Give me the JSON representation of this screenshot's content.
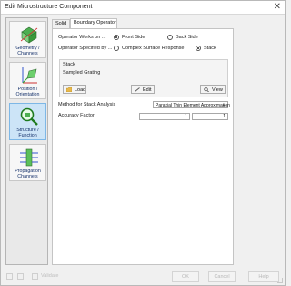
{
  "window": {
    "title": "Edit Microstructure Component"
  },
  "sidebar": {
    "items": [
      {
        "label_line1": "Geometry /",
        "label_line2": "Channels",
        "icon": "geometry-icon"
      },
      {
        "label_line1": "Position /",
        "label_line2": "Orientation",
        "icon": "position-icon"
      },
      {
        "label_line1": "Structure /",
        "label_line2": "Function",
        "icon": "magnifier-icon"
      },
      {
        "label_line1": "Propagation",
        "label_line2": "Channels",
        "icon": "channels-icon"
      }
    ]
  },
  "tabs": [
    {
      "label": "Solid"
    },
    {
      "label": "Boundary Operator"
    }
  ],
  "form": {
    "operator_works_on": {
      "label": "Operator Works on ...",
      "options": [
        "Front Side",
        "Back Side"
      ],
      "selected": "Front Side"
    },
    "operator_specified_by": {
      "label": "Operator Specified by ...",
      "options": [
        "Complex Surface Response",
        "Stack"
      ],
      "selected": "Stack"
    },
    "stack": {
      "title": "Stack",
      "value": "Sampled Grating",
      "load_label": "Load",
      "edit_label": "Edit",
      "view_label": "View"
    },
    "method": {
      "label": "Method for Stack Analysis",
      "value": "Paraxial Thin Element Approximation"
    },
    "accuracy": {
      "label": "Accuracy Factor",
      "value1": "1",
      "value2": "1"
    }
  },
  "footer": {
    "validate_label": "Validate",
    "ok_label": "OK",
    "cancel_label": "Cancel",
    "help_label": "Help"
  },
  "colors": {
    "accent": "#cce4f7",
    "active_border": "#7db7e6"
  }
}
